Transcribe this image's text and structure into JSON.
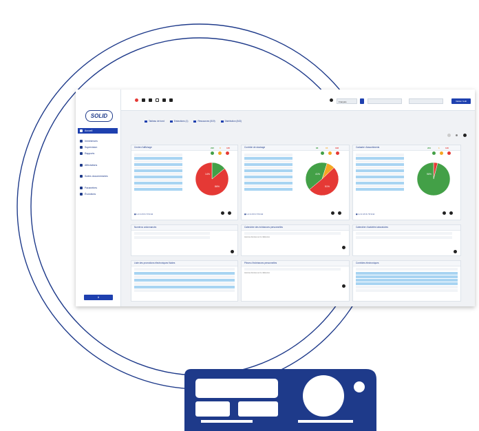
{
  "colors": {
    "brand_blue": "#1e40af",
    "pie_red": "#e53935",
    "pie_green": "#43a047",
    "pie_orange": "#f5a623",
    "row_highlight": "#a8d4f2"
  },
  "logo": {
    "text": "SOLID"
  },
  "sidebar": {
    "items": [
      {
        "label": "Accueil",
        "icon": "home-icon",
        "active": true
      },
      {
        "label": "Imminences",
        "icon": "alert-icon"
      },
      {
        "label": "Supervision",
        "icon": "chart-icon"
      },
      {
        "label": "Rapports",
        "icon": "report-icon"
      },
      {
        "label": "Affectations",
        "icon": "link-icon"
      },
      {
        "label": "Suites documentaires",
        "icon": "document-icon"
      },
      {
        "label": "Paramètres",
        "icon": "gear-icon"
      },
      {
        "label": "Évolutions",
        "icon": "refresh-icon"
      }
    ]
  },
  "topbar": {
    "language_value": "Français",
    "button_label": "Valider l'édit"
  },
  "tabs": [
    {
      "label": "Tableau de bord"
    },
    {
      "label": "Extractions (1)"
    },
    {
      "label": "Ressources (519)"
    },
    {
      "label": "Distribution (543)"
    }
  ],
  "panels": {
    "p1": {
      "title": "Centre d'affichage",
      "badges": [
        "295",
        "0",
        "135"
      ]
    },
    "p2": {
      "title": "Contrôle de stockage",
      "badges": [
        "88",
        "15",
        "108"
      ]
    },
    "p3": {
      "title": "Cadastre d'assortiments",
      "badges": [
        "284",
        "1",
        "116"
      ]
    },
    "p4": {
      "title": "Numéros ordonnancés",
      "empty": ""
    },
    "p5": {
      "title": "Calendrier des échéances personnelles",
      "empty": "Aucune donnée sur le référence"
    },
    "p6": {
      "title": "Calendrier d'activités laboratoires",
      "empty": ""
    },
    "p7": {
      "title": "Liste des promotions électroniques fluides",
      "empty": ""
    },
    "p8": {
      "title": "Pièces d'échéances personnelles",
      "empty": "Aucune donnée sur le référence"
    },
    "p9": {
      "title": "Contrôles électroniques",
      "empty": ""
    }
  },
  "chart_data": [
    {
      "type": "pie",
      "slices": [
        {
          "label": "A",
          "value": 14
        },
        {
          "label": "B",
          "value": 86
        }
      ],
      "values_shown": [
        "14%",
        "86%"
      ]
    },
    {
      "type": "pie",
      "slices": [
        {
          "label": "A",
          "value": 41
        },
        {
          "label": "B",
          "value": 8
        },
        {
          "label": "C",
          "value": 51
        }
      ],
      "values_shown": [
        "41%",
        "51%"
      ]
    },
    {
      "type": "pie",
      "slices": [
        {
          "label": "A",
          "value": 4
        },
        {
          "label": "B",
          "value": 96
        }
      ],
      "values_shown": [
        "96%"
      ]
    }
  ]
}
